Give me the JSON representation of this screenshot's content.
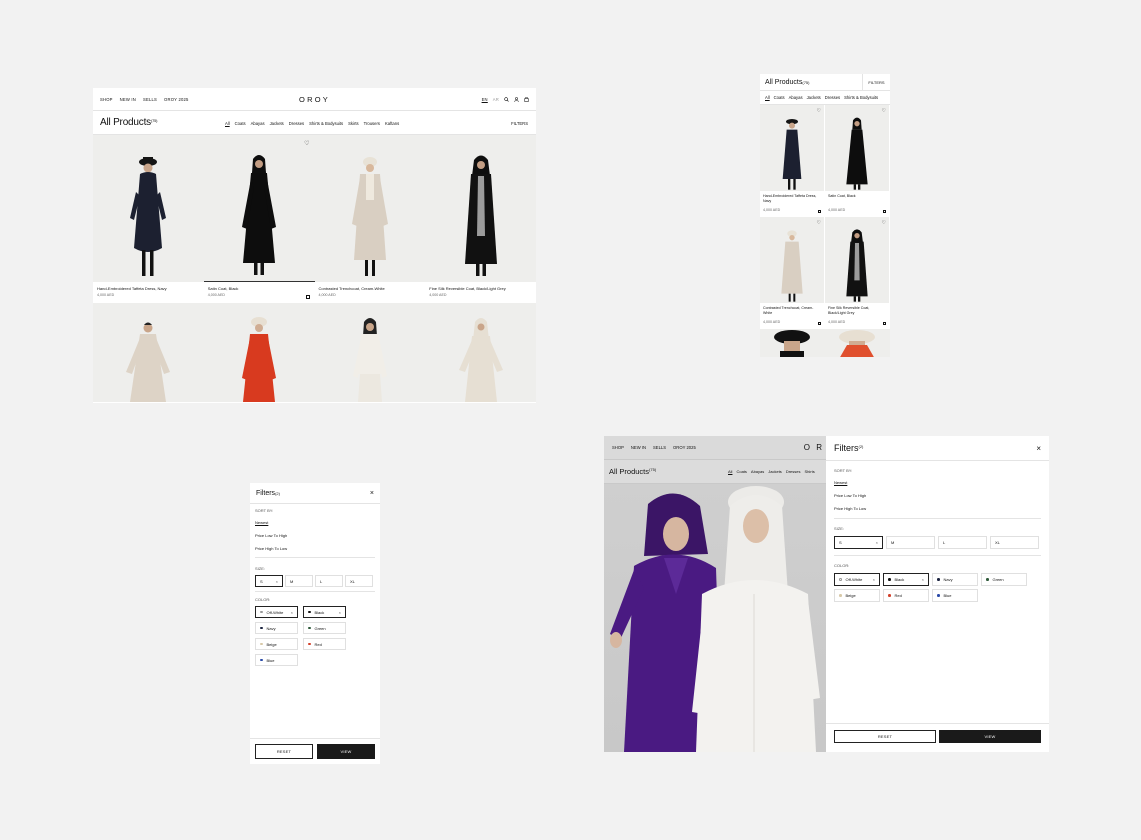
{
  "desktop": {
    "nav": [
      "SHOP",
      "NEW IN",
      "SELLS",
      "OROY 2025"
    ],
    "logo": "OROY",
    "lang_en": "EN",
    "lang_ar": "AR",
    "title": "All Products",
    "count": "(75)",
    "categories": [
      "All",
      "Coats",
      "Abayas",
      "Jackets",
      "Dresses",
      "Shirts & Bodysuits",
      "Skirts",
      "Trousers",
      "Kaftans"
    ],
    "filters_label": "FILTERS",
    "products": [
      {
        "name": "Hand-Embroidered Taffeta Dress, Navy",
        "price": "4,000 AED"
      },
      {
        "name": "Satin Coat, Black",
        "price": "4,000 AED"
      },
      {
        "name": "Contrasted Trenchcoat, Cream-White",
        "price": "4,000 AED"
      },
      {
        "name": "Fine Silk Reversible Coat, Black/Light Grey",
        "price": "4,000 AED"
      }
    ]
  },
  "mobile": {
    "title": "All Products",
    "count": "(75)",
    "filters_label": "FILTERS",
    "categories": [
      "All",
      "Coats",
      "Abayas",
      "Jackets",
      "Dresses",
      "Shirts & Bodysuits"
    ],
    "products": [
      {
        "name": "Hand-Embroidered Taffeta Dress, Navy",
        "price": "4,000 AED"
      },
      {
        "name": "Satin Coat, Black",
        "price": "4,000 AED"
      },
      {
        "name": "Contrasted Trenchcoat, Cream-White",
        "price": "4,000 AED"
      },
      {
        "name": "Fine Silk Reversible Coat, Black/Light Grey",
        "price": "4,000 AED"
      }
    ]
  },
  "filters": {
    "title": "Filters",
    "count": "(2)",
    "sort_label": "SORT BY:",
    "sort_options": [
      "Newest",
      "Price Low To High",
      "Price High To Low"
    ],
    "size_label": "SIZE:",
    "sizes": [
      "S",
      "M",
      "L",
      "XL"
    ],
    "color_label": "COLOR:",
    "colors": [
      {
        "name": "Off-White",
        "hex": "#f4f1ea",
        "selected": true
      },
      {
        "name": "Black",
        "hex": "#111111",
        "selected": true
      },
      {
        "name": "Navy",
        "hex": "#1c2440",
        "selected": false
      },
      {
        "name": "Green",
        "hex": "#2f5a3a",
        "selected": false
      },
      {
        "name": "Beige",
        "hex": "#d8c9a8",
        "selected": false
      },
      {
        "name": "Red",
        "hex": "#d2402a",
        "selected": false
      },
      {
        "name": "Blue",
        "hex": "#2a4aa8",
        "selected": false
      }
    ],
    "reset_label": "RESET",
    "view_label": "VIEW"
  },
  "tablet": {
    "nav": [
      "SHOP",
      "NEW IN",
      "SELLS",
      "OROY 2025"
    ],
    "logo": "O R",
    "title": "All Products",
    "count": "(75)",
    "categories": [
      "All",
      "Coats",
      "Abayas",
      "Jackets",
      "Dresses",
      "Shirts"
    ]
  },
  "colors": {
    "background": "#f2f2f2",
    "ink": "#111111",
    "button_dark": "#1a1a1a"
  }
}
